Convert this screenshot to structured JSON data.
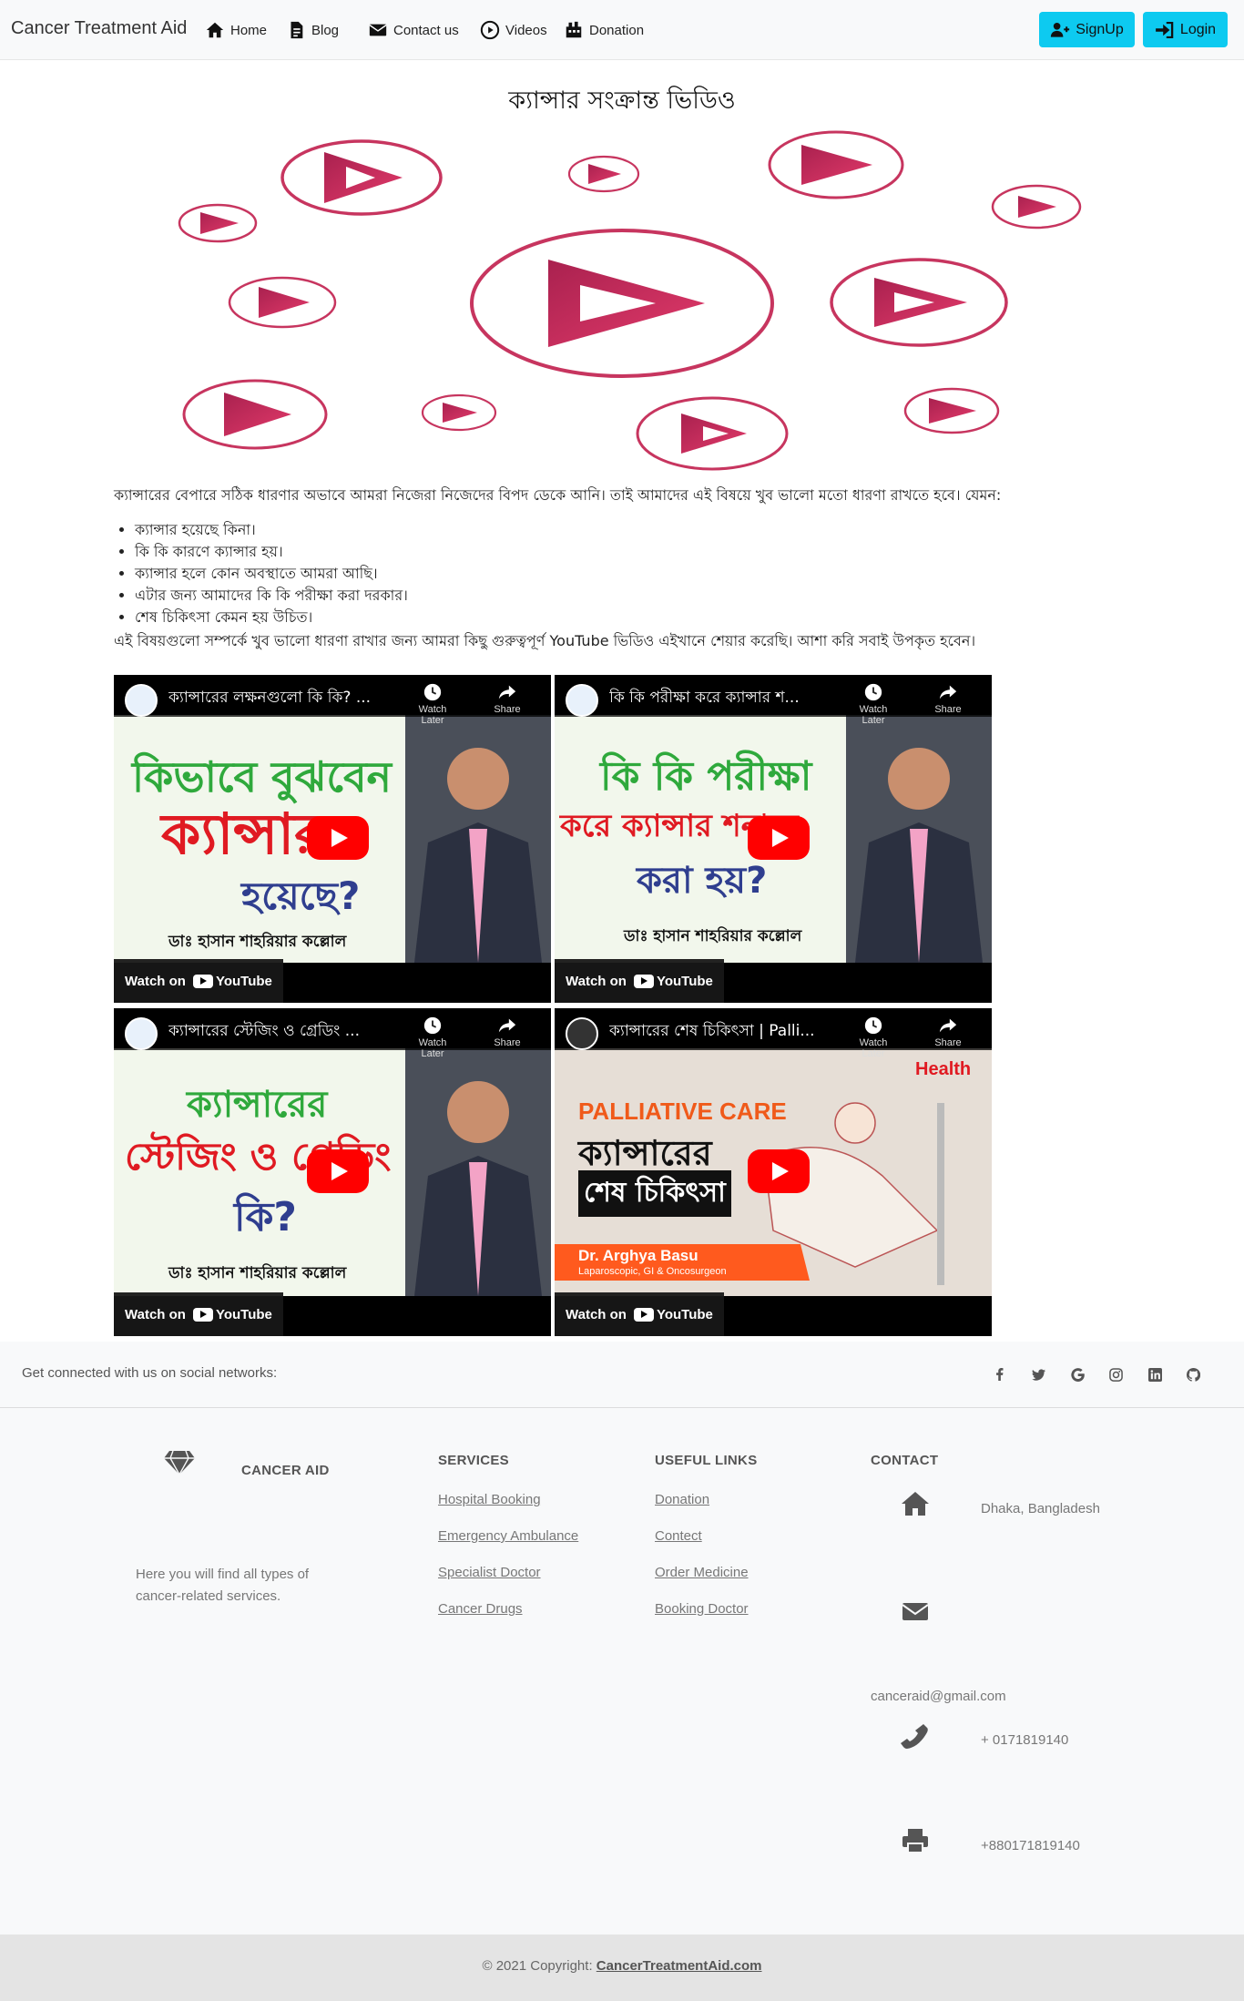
{
  "nav": {
    "brand": "Cancer Treatment Aid",
    "home": "Home",
    "blog": "Blog",
    "contact": "Contact us",
    "videos": "Videos",
    "donation": "Donation",
    "signup": "SignUp",
    "login": "Login"
  },
  "page": {
    "title": "ক্যান্সার সংক্রান্ত ভিডিও",
    "intro": "ক্যান্সারের বেপারে সঠিক ধারণার অভাবে আমরা নিজেরা নিজেদের বিপদ ডেকে আনি। তাই আমাদের এই বিষয়ে খুব ভালো মতো ধারণা রাখতে হবে। যেমন:",
    "bullets": [
      "ক্যান্সার হয়েছে কিনা।",
      "কি কি কারণে ক্যান্সার হয়।",
      "ক্যান্সার হলে কোন অবস্থাতে আমরা আছি।",
      "এটার জন্য আমাদের কি কি পরীক্ষা করা দরকার।",
      "শেষ চিকিৎসা কেমন হয় উচিত।"
    ],
    "outro": "এই বিষয়গুলো সম্পর্কে খুব ভালো ধারণা রাখার জন্য আমরা কিছু গুরুত্বপূর্ণ YouTube ভিডিও এইখানে শেয়ার করেছি। আশা করি সবাই উপকৃত হবেন।"
  },
  "videos": [
    {
      "title": "ক্যান্সারের লক্ষনগুলো কি কি? ...",
      "thumb_lines": [
        "কিভাবে বুঝবেন",
        "ক্যান্সার",
        "হয়েছে?"
      ],
      "doctor": "ডাঃ হাসান শাহরিয়ার কল্লোল"
    },
    {
      "title": "কি কি পরীক্ষা করে ক্যান্সার শ...",
      "thumb_lines": [
        "কি কি পরীক্ষা",
        "করে ক্যান্সার শনাক্ত",
        "করা হয়?"
      ],
      "doctor": "ডাঃ হাসান শাহরিয়ার কল্লোল"
    },
    {
      "title": "ক্যান্সারের স্টেজিং ও গ্রেডিং ...",
      "thumb_lines": [
        "ক্যান্সারের",
        "স্টেজিং ও গ্রেডিং",
        "কি?"
      ],
      "doctor": "ডাঃ হাসান শাহরিয়ার কল্লোল"
    },
    {
      "title": "ক্যান্সারের শেষ চিকিৎসা | Palli...",
      "thumb_lines": [
        "PALLIATIVE CARE",
        "ক্যান্সারের",
        "শেষ চিকিৎসা"
      ],
      "doctor": "Dr. Arghya Basu",
      "doctor_sub": "Laparoscopic, GI & Oncosurgeon",
      "badge": "Health"
    }
  ],
  "video_ui": {
    "watch_later": "Watch Later",
    "share": "Share",
    "watch_on": "Watch on",
    "youtube": "YouTube"
  },
  "social": {
    "text": "Get connected with us on social networks:",
    "icons": [
      "facebook-icon",
      "twitter-icon",
      "google-icon",
      "instagram-icon",
      "linkedin-icon",
      "github-icon"
    ]
  },
  "footer": {
    "brand": "CANCER AID",
    "about": "Here you will find all types of cancer-related services.",
    "services_head": "SERVICES",
    "services": [
      "Hospital Booking",
      "Emergency Ambulance",
      "Specialist Doctor",
      "Cancer Drugs"
    ],
    "links_head": "USEFUL LINKS",
    "links": [
      "Donation",
      "Contect",
      "Order Medicine",
      "Booking Doctor"
    ],
    "contact_head": "CONTACT",
    "address": "Dhaka, Bangladesh",
    "email": "canceraid@gmail.com",
    "phone": "+ 0171819140",
    "fax": "+880171819140",
    "copyright_prefix": "© 2021 Copyright:",
    "copyright_link": "CancerTreatmentAid.com"
  },
  "colors": {
    "accent": "#0dcaf0",
    "play_pink": "#c2275a",
    "youtube_red": "#ff0000"
  }
}
